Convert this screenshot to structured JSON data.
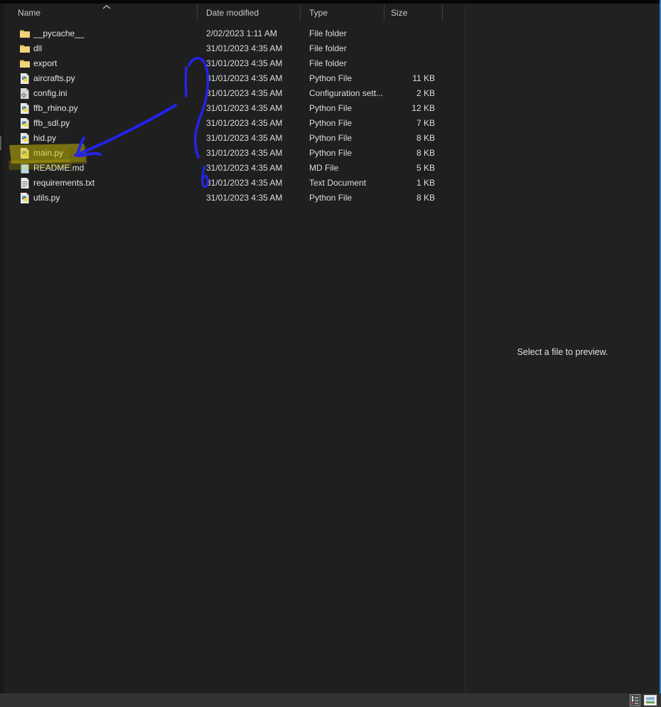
{
  "file_list": {
    "headers": {
      "name": "Name",
      "date": "Date modified",
      "type": "Type",
      "size": "Size"
    },
    "sort": {
      "column": "Name",
      "direction": "ascending"
    },
    "rows": [
      {
        "icon": "folder-icon",
        "name": "__pycache__",
        "date": "2/02/2023 1:11 AM",
        "type": "File folder",
        "size": ""
      },
      {
        "icon": "folder-icon",
        "name": "dll",
        "date": "31/01/2023 4:35 AM",
        "type": "File folder",
        "size": ""
      },
      {
        "icon": "folder-icon",
        "name": "export",
        "date": "31/01/2023 4:35 AM",
        "type": "File folder",
        "size": ""
      },
      {
        "icon": "python-file-icon",
        "name": "aircrafts.py",
        "date": "31/01/2023 4:35 AM",
        "type": "Python File",
        "size": "11 KB"
      },
      {
        "icon": "ini-file-icon",
        "name": "config.ini",
        "date": "31/01/2023 4:35 AM",
        "type": "Configuration sett...",
        "size": "2 KB"
      },
      {
        "icon": "python-file-icon",
        "name": "ffb_rhino.py",
        "date": "31/01/2023 4:35 AM",
        "type": "Python File",
        "size": "12 KB"
      },
      {
        "icon": "python-file-icon",
        "name": "ffb_sdl.py",
        "date": "31/01/2023 4:35 AM",
        "type": "Python File",
        "size": "7 KB"
      },
      {
        "icon": "python-file-icon",
        "name": "hid.py",
        "date": "31/01/2023 4:35 AM",
        "type": "Python File",
        "size": "8 KB"
      },
      {
        "icon": "python-file-icon",
        "name": "main.py",
        "date": "31/01/2023 4:35 AM",
        "type": "Python File",
        "size": "8 KB",
        "highlighted": true
      },
      {
        "icon": "notebook-file-icon",
        "name": "README.md",
        "date": "31/01/2023 4:35 AM",
        "type": "MD File",
        "size": "5 KB"
      },
      {
        "icon": "text-file-icon",
        "name": "requirements.txt",
        "date": "31/01/2023 4:35 AM",
        "type": "Text Document",
        "size": "1 KB"
      },
      {
        "icon": "python-file-icon",
        "name": "utils.py",
        "date": "31/01/2023 4:35 AM",
        "type": "Python File",
        "size": "8 KB"
      }
    ]
  },
  "preview": {
    "message": "Select a file to preview."
  },
  "status_bar": {
    "views": [
      "details-view",
      "thumbnail-view"
    ],
    "active_view": "details-view"
  },
  "annotations": {
    "pen_color": "#2323ec",
    "highlight_color": "#d2c300",
    "highlight_target": "main.py",
    "shapes": [
      "arrow-to-main-py",
      "curved-stroke-over-dates",
      "small-loop-scribble",
      "yellow-highlight"
    ]
  },
  "window": {
    "accent_color": "#2d7dd2"
  }
}
